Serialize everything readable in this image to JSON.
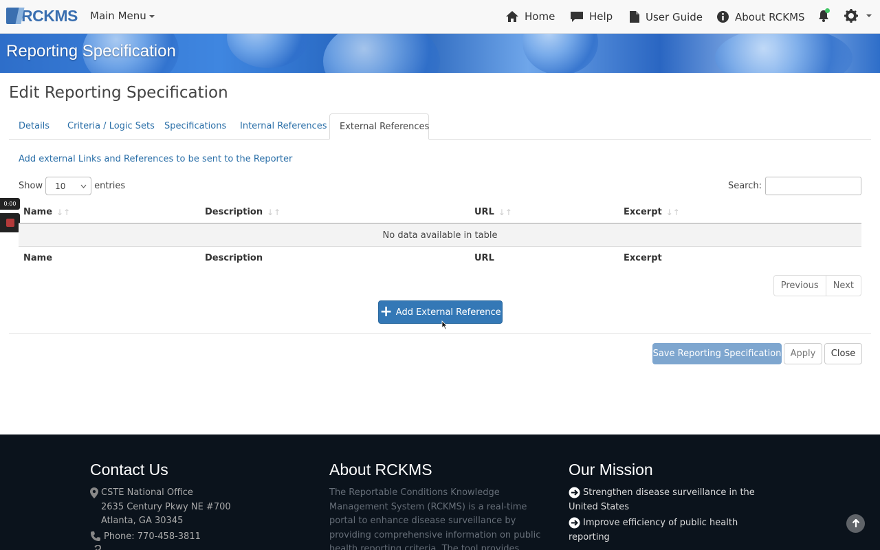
{
  "navbar": {
    "logo_text": "RCKMS",
    "main_menu_label": "Main Menu",
    "links": [
      {
        "label": "Home",
        "icon": "home-icon"
      },
      {
        "label": "Help",
        "icon": "chat-icon"
      },
      {
        "label": "User Guide",
        "icon": "document-icon"
      },
      {
        "label": "About RCKMS",
        "icon": "info-icon"
      }
    ],
    "notification_dot_color": "#44c767"
  },
  "banner": {
    "title": "Reporting Specification"
  },
  "page": {
    "title": "Edit Reporting Specification"
  },
  "tabs": [
    {
      "label": "Details",
      "active": false
    },
    {
      "label": "Criteria / Logic Sets",
      "active": false
    },
    {
      "label": "Specifications",
      "active": false
    },
    {
      "label": "Internal References",
      "active": false
    },
    {
      "label": "External References",
      "active": true
    }
  ],
  "instruction": "Add external Links and References to be sent to the Reporter",
  "entries": {
    "show_label": "Show",
    "value": "10",
    "suffix": "entries"
  },
  "search": {
    "label": "Search:",
    "placeholder": ""
  },
  "recorder": {
    "time": "0:00"
  },
  "table": {
    "columns": [
      "Name",
      "Description",
      "URL",
      "Excerpt"
    ],
    "empty_message": "No data available in table"
  },
  "pagination": {
    "previous": "Previous",
    "next": "Next"
  },
  "add_button": {
    "label": "Add External Reference"
  },
  "actions": {
    "save": "Save Reporting Specification",
    "apply": "Apply",
    "close": "Close"
  },
  "colors": {
    "primary": "#3478b6",
    "link": "#2a6fa8",
    "footer_bg": "#0b131c"
  },
  "footer": {
    "contact": {
      "title": "Contact Us",
      "office": "CSTE National Office",
      "street": "2635 Century Pkwy NE #700",
      "city": "Atlanta, GA 30345",
      "phone": "Phone: 770-458-3811"
    },
    "about": {
      "title": "About RCKMS",
      "text": "The Reportable Conditions Knowledge Management System (RCKMS) is a real-time portal to enhance disease surveillance by providing comprehensive information on public health reporting criteria. The tool provides public health reporters about the “who"
    },
    "mission": {
      "title": "Our Mission",
      "items": [
        "Strengthen disease surveillance in the United States",
        "Improve efficiency of public health reporting"
      ]
    }
  }
}
